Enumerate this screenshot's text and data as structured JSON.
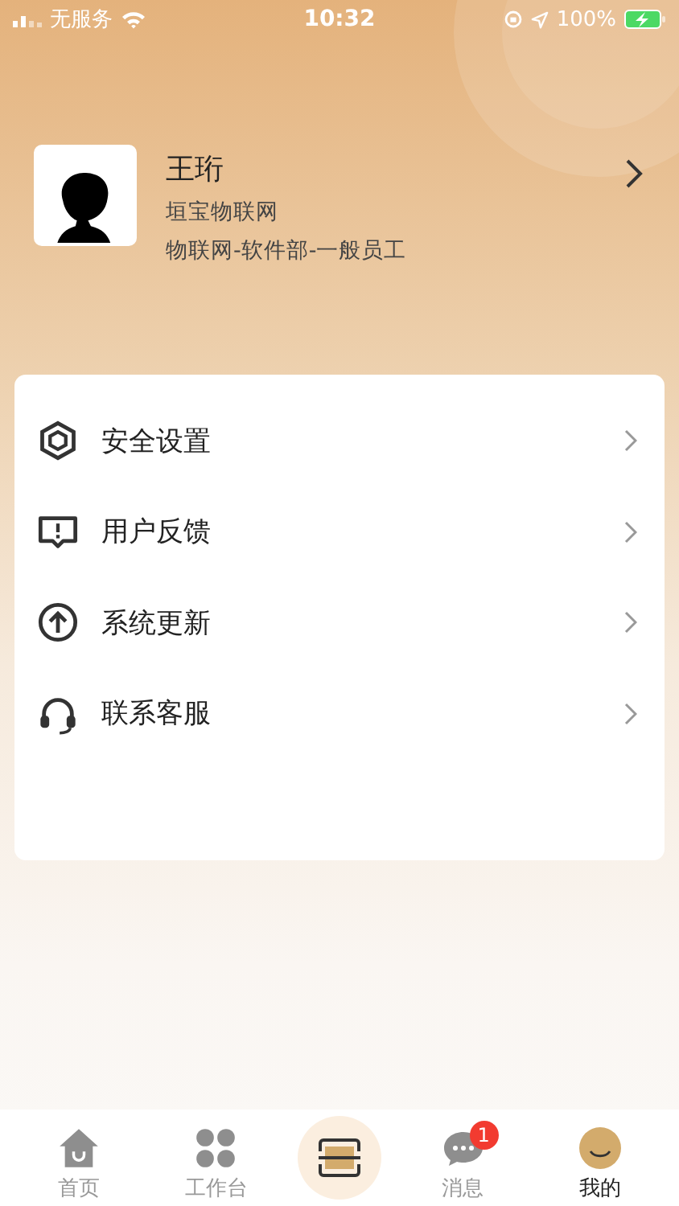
{
  "status_bar": {
    "carrier": "无服务",
    "time": "10:32",
    "battery": "100%"
  },
  "profile": {
    "name": "王珩",
    "company": "垣宝物联网",
    "department": "物联网-软件部-一般员工"
  },
  "menu": [
    {
      "kind": "shield",
      "label": "安全设置"
    },
    {
      "kind": "feedback",
      "label": "用户反馈"
    },
    {
      "kind": "update",
      "label": "系统更新"
    },
    {
      "kind": "headset",
      "label": "联系客服"
    }
  ],
  "tab_bar": [
    {
      "kind": "home",
      "label": "首页",
      "selected": false
    },
    {
      "kind": "grid",
      "label": "工作台",
      "selected": false
    },
    {
      "kind": "scan",
      "selected": false
    },
    {
      "kind": "chat",
      "label": "消息",
      "selected": false,
      "badge": "1"
    },
    {
      "kind": "avatar",
      "label": "我的",
      "selected": true
    }
  ]
}
